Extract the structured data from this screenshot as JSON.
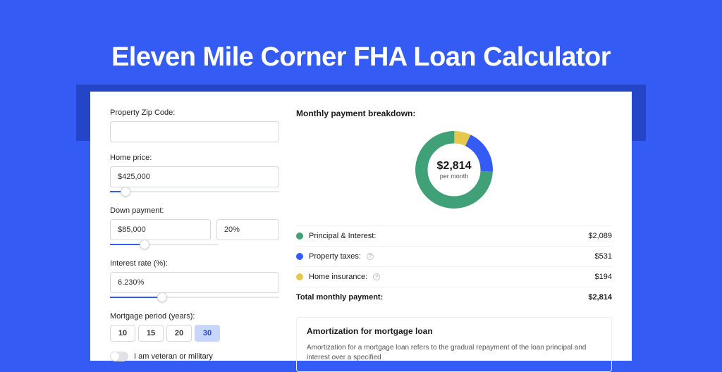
{
  "page": {
    "title": "Eleven Mile Corner FHA Loan Calculator"
  },
  "form": {
    "zip_label": "Property Zip Code:",
    "zip_value": "",
    "home_price_label": "Home price:",
    "home_price_value": "$425,000",
    "home_price_slider_pct": 9,
    "down_payment_label": "Down payment:",
    "down_payment_value": "$85,000",
    "down_payment_pct_value": "20%",
    "down_payment_slider_pct": 20,
    "interest_label": "Interest rate (%):",
    "interest_value": "6.230%",
    "interest_slider_pct": 31,
    "period_label": "Mortgage period (years):",
    "period_options": [
      "10",
      "15",
      "20",
      "30"
    ],
    "period_selected": "30",
    "veteran_label": "I am veteran or military",
    "veteran_on": false
  },
  "breakdown": {
    "heading": "Monthly payment breakdown:",
    "center_amount": "$2,814",
    "center_sub": "per month",
    "items": [
      {
        "label": "Principal & Interest:",
        "value": "$2,089",
        "color": "green",
        "info": false
      },
      {
        "label": "Property taxes:",
        "value": "$531",
        "color": "blue",
        "info": true
      },
      {
        "label": "Home insurance:",
        "value": "$194",
        "color": "yellow",
        "info": true
      }
    ],
    "total_label": "Total monthly payment:",
    "total_value": "$2,814"
  },
  "amortization": {
    "title": "Amortization for mortgage loan",
    "body": "Amortization for a mortgage loan refers to the gradual repayment of the loan principal and interest over a specified"
  },
  "chart_data": {
    "type": "pie",
    "title": "Monthly payment breakdown",
    "series": [
      {
        "name": "Principal & Interest",
        "value": 2089,
        "color": "#40a077"
      },
      {
        "name": "Property taxes",
        "value": 531,
        "color": "#355bf5"
      },
      {
        "name": "Home insurance",
        "value": 194,
        "color": "#e7c84f"
      }
    ],
    "total": 2814,
    "center_label": "$2,814 per month"
  }
}
